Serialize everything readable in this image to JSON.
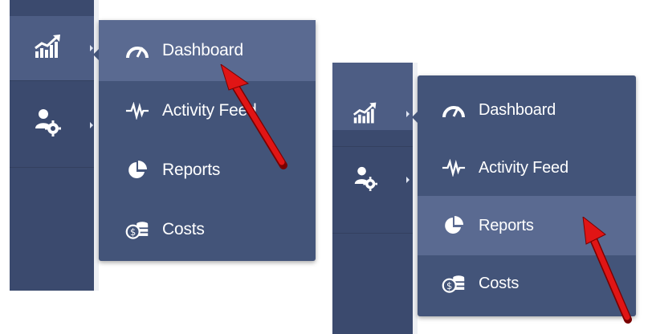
{
  "menu": {
    "items": [
      {
        "label": "Dashboard",
        "icon": "speedometer-icon"
      },
      {
        "label": "Activity Feed",
        "icon": "pulse-icon"
      },
      {
        "label": "Reports",
        "icon": "pie-chart-icon"
      },
      {
        "label": "Costs",
        "icon": "coins-icon"
      }
    ]
  },
  "rail": {
    "items": [
      {
        "name": "analytics",
        "icon": "bar-chart-trend-icon"
      },
      {
        "name": "user-settings",
        "icon": "user-gear-icon"
      }
    ]
  },
  "screens": [
    {
      "hovered_item": "Dashboard",
      "pointer": "red-arrow"
    },
    {
      "hovered_item": "Reports",
      "pointer": "red-arrow"
    }
  ],
  "colors": {
    "rail": "#3b4a6e",
    "rail_active": "#4d5d84",
    "menu_bg": "#435479",
    "menu_highlight": "#5a6a91",
    "text": "#ffffff",
    "pointer": "#e01515"
  }
}
